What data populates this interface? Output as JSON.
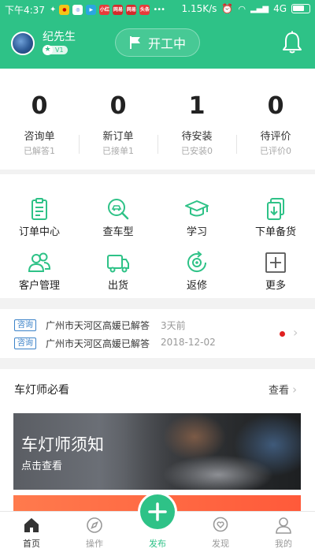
{
  "status_bar": {
    "time": "下午4:37",
    "net_speed": "1.15K/s",
    "network": "4G",
    "app_badges": [
      "小红",
      "网易",
      "网易",
      "头条"
    ]
  },
  "header": {
    "username": "纪先生",
    "level": "V1",
    "work_status": "开工中",
    "accent_color": "#2ec287",
    "icons": [
      "avatar",
      "flag-icon",
      "bell-icon"
    ]
  },
  "stats": [
    {
      "value": "0",
      "label": "咨询单",
      "sub": "已解答1"
    },
    {
      "value": "0",
      "label": "新订单",
      "sub": "已接单1"
    },
    {
      "value": "1",
      "label": "待安装",
      "sub": "已安装0"
    },
    {
      "value": "0",
      "label": "待评价",
      "sub": "已评价0"
    }
  ],
  "menu": [
    {
      "label": "订单中心",
      "icon": "clipboard-icon"
    },
    {
      "label": "查车型",
      "icon": "car-search-icon"
    },
    {
      "label": "学习",
      "icon": "graduation-cap-icon"
    },
    {
      "label": "下单备货",
      "icon": "download-doc-icon"
    },
    {
      "label": "客户管理",
      "icon": "people-icon"
    },
    {
      "label": "出货",
      "icon": "truck-icon"
    },
    {
      "label": "返修",
      "icon": "repair-icon"
    },
    {
      "label": "更多",
      "icon": "plus-box-icon"
    }
  ],
  "notices": [
    {
      "tag": "咨询",
      "text": "广州市天河区高媛已解答",
      "time": "3天前"
    },
    {
      "tag": "咨询",
      "text": "广州市天河区高媛已解答",
      "time": "2018-12-02"
    }
  ],
  "section": {
    "title": "车灯师必看",
    "more": "查看",
    "banner_title": "车灯师须知",
    "banner_sub": "点击查看"
  },
  "tabs": [
    {
      "label": "首页",
      "icon": "home-icon",
      "active": true
    },
    {
      "label": "操作",
      "icon": "compass-icon"
    },
    {
      "label": "发布",
      "icon": "plus-icon"
    },
    {
      "label": "发现",
      "icon": "heart-chat-icon"
    },
    {
      "label": "我的",
      "icon": "user-icon"
    }
  ]
}
